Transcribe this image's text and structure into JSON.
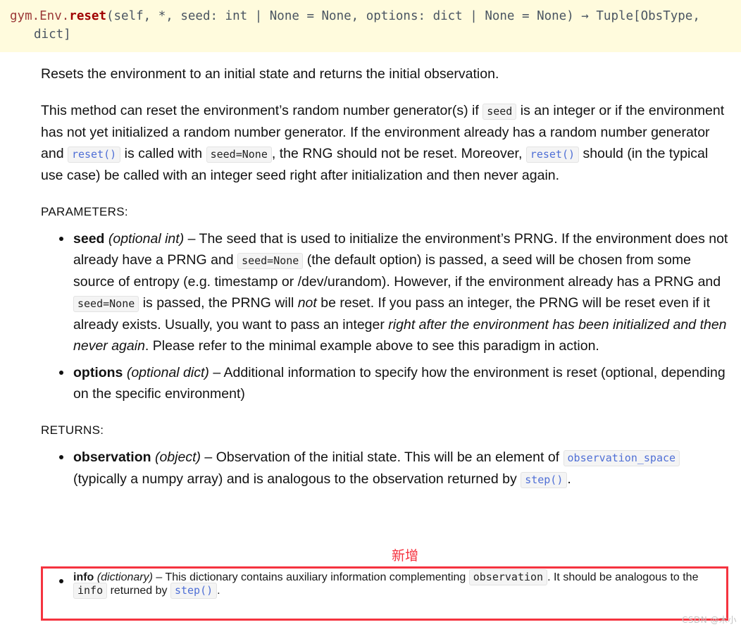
{
  "signature": {
    "module": "gym.Env.",
    "name": "reset",
    "params_line1": "(self, *, seed: int | None = None, options: dict | None = None)",
    "arrow": "→",
    "return_line1": " Tuple[ObsType,",
    "line2": "dict]"
  },
  "paragraphs": {
    "intro": "Resets the environment to an initial state and returns the initial observation.",
    "rng_a": "This method can reset the environment’s random number generator(s) if",
    "rng_code_seed": "seed",
    "rng_b": "is an integer or if the environment has not yet initialized a random number generator. If the environment already has a random number generator and",
    "rng_code_reset": "reset()",
    "rng_c": "is called with",
    "rng_code_seednone": "seed=None",
    "rng_d": ", the RNG should not be reset. Moreover,",
    "rng_code_reset2": "reset()",
    "rng_e": "should (in the typical use case) be called with an integer seed right after initialization and then never again."
  },
  "sections": {
    "parameters_title": "PARAMETERS:",
    "returns_title": "RETURNS:"
  },
  "parameters": {
    "seed": {
      "term": "seed",
      "type": "(optional int)",
      "dash": "–",
      "text_a": "The seed that is used to initialize the environment’s PRNG. If the environment does not already have a PRNG and",
      "code_a": "seed=None",
      "text_b": "(the default option) is passed, a seed will be chosen from some source of entropy (e.g. timestamp or /dev/urandom). However, if the environment already has a PRNG and",
      "code_b": "seed=None",
      "text_c": "is passed, the PRNG will",
      "emph_not": "not",
      "text_d": "be reset. If you pass an integer, the PRNG will be reset even if it already exists. Usually, you want to pass an integer",
      "emph_phrase": "right after the environment has been initialized and then never again",
      "text_e": ". Please refer to the minimal example above to see this paradigm in action."
    },
    "options": {
      "term": "options",
      "type": "(optional dict)",
      "dash": "–",
      "text_a": "Additional information to specify how the environment is reset (optional, depending on the specific environment)"
    }
  },
  "returns": {
    "observation": {
      "term": "observation",
      "type": "(object)",
      "dash": "–",
      "text_a": "Observation of the initial state. This will be an element of",
      "code_a": "observation_space",
      "text_b": "(typically a numpy array) and is analogous to the observation returned by",
      "code_b": "step()",
      "text_c": "."
    },
    "info": {
      "term": "info",
      "type": "(dictionary)",
      "dash": "–",
      "text_a": "This dictionary contains auxiliary information complementing",
      "code_a": "observation",
      "text_b": ". It should be analogous to the",
      "code_b": "info",
      "text_c": "returned by",
      "code_c": "step()",
      "text_d": "."
    }
  },
  "annotations": {
    "new_label": "新增",
    "watermark": "CSDN @木小",
    "highlight_color": "#f5333f",
    "signature_bg": "#fffbdd",
    "link_color": "#4f6fd6"
  }
}
